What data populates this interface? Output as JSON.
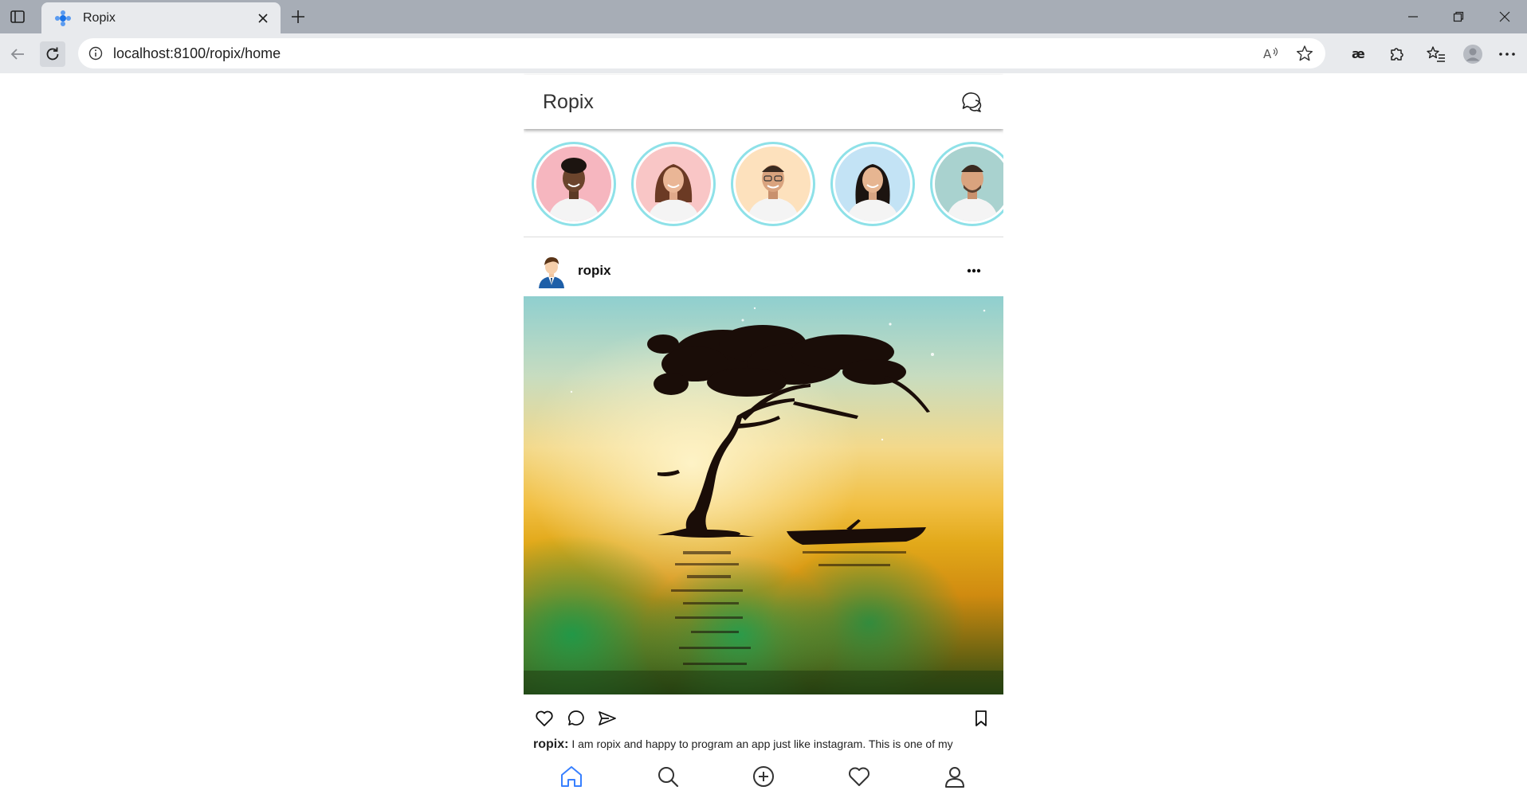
{
  "browser": {
    "tab_title": "Ropix",
    "url": "localhost:8100/ropix/home",
    "accent_color": "#1a73e8"
  },
  "app": {
    "title": "Ropix",
    "stories": [
      {
        "name": "story-1",
        "bg": "#f6b6bf"
      },
      {
        "name": "story-2",
        "bg": "#f9c6c6"
      },
      {
        "name": "story-3",
        "bg": "#fde1bd"
      },
      {
        "name": "story-4",
        "bg": "#c3e3f5"
      },
      {
        "name": "story-5",
        "bg": "#a9d2cf"
      }
    ],
    "post": {
      "username": "ropix",
      "caption_user": "ropix:",
      "caption_text": " I am ropix and happy to program an app just like instagram. This is one of my"
    },
    "tab_icons": [
      "home-icon",
      "search-icon",
      "add-circle-icon",
      "heart-icon",
      "person-icon"
    ],
    "active_tab_color": "#3880ff"
  }
}
